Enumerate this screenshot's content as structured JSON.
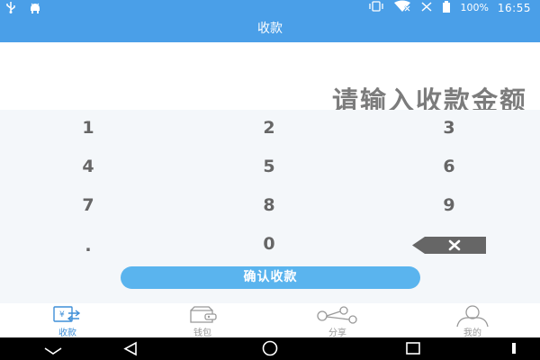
{
  "status_bar": {
    "battery": "100%",
    "time": "16:55",
    "icons": [
      "usb-icon",
      "android-debug-icon",
      "vibrate-icon",
      "wifi-off-icon",
      "signal-off-icon",
      "battery-icon"
    ]
  },
  "app_bar": {
    "title": "收款"
  },
  "amount": {
    "placeholder": "请输入收款金额"
  },
  "keypad": {
    "keys": [
      "1",
      "2",
      "3",
      "4",
      "5",
      "6",
      "7",
      "8",
      "9",
      ".",
      "0"
    ],
    "backspace_icon": "backspace-icon"
  },
  "confirm_button": {
    "label": "确认收款"
  },
  "tabs": [
    {
      "label": "收款",
      "icon": "receive-payment-icon",
      "active": true
    },
    {
      "label": "钱包",
      "icon": "wallet-icon",
      "active": false
    },
    {
      "label": "分享",
      "icon": "share-icon",
      "active": false
    },
    {
      "label": "我的",
      "icon": "profile-icon",
      "active": false
    }
  ],
  "colors": {
    "primary": "#4a9fe8",
    "button": "#5ab4ee",
    "active_tab": "#3f8fd8",
    "keypad_bg": "#f4f7fa"
  },
  "system_nav": [
    "back-icon",
    "home-icon",
    "recents-icon"
  ]
}
